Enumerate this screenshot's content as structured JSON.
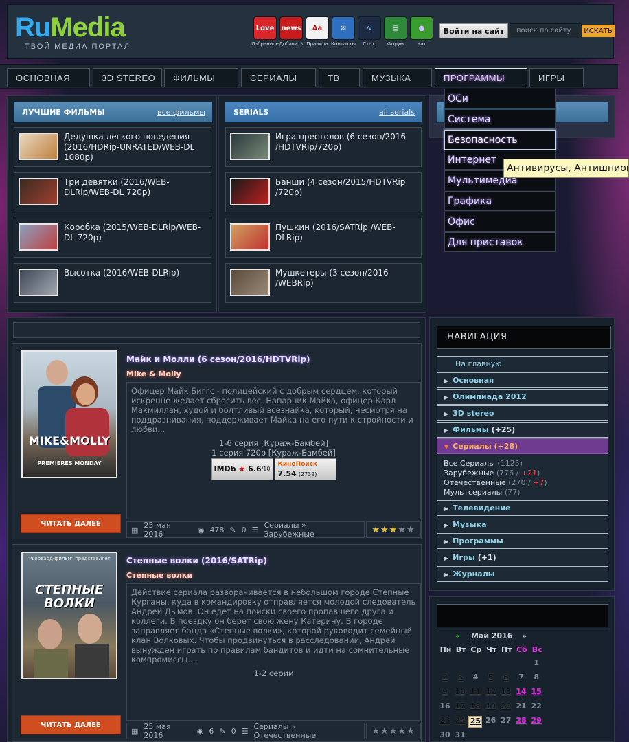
{
  "site": {
    "logo_ru": "Ru",
    "logo_media": "Media",
    "tagline": "ТВОЙ МЕДИА ПОРТАЛ"
  },
  "header_icons": [
    {
      "label": "Избранное",
      "icon": "heart-icon",
      "glyph": "Love"
    },
    {
      "label": "Добавить",
      "icon": "plus-news-icon",
      "glyph": "news"
    },
    {
      "label": "Правила",
      "icon": "rules-icon",
      "glyph": "Aa"
    },
    {
      "label": "Контакты",
      "icon": "mail-icon",
      "glyph": "✉"
    },
    {
      "label": "Стат.",
      "icon": "stats-icon",
      "glyph": "∿"
    },
    {
      "label": "Форум",
      "icon": "forum-icon",
      "glyph": "▤"
    },
    {
      "label": "Чат",
      "icon": "chat-icon",
      "glyph": "●"
    }
  ],
  "login_label": "Войти на сайт",
  "search": {
    "placeholder": "поиск по сайту",
    "button": "ИСКАТЬ"
  },
  "nav": [
    "ОСНОВНАЯ",
    "3D STEREO",
    "ФИЛЬМЫ",
    "СЕРИАЛЫ",
    "ТВ",
    "МУЗЫКА",
    "ПРОГРАММЫ",
    "ИГРЫ"
  ],
  "dropdown": [
    "ОСи",
    "Система",
    "Безопасность",
    "Интернет",
    "Мультимедиа",
    "Графика",
    "Офис",
    "Для приставок"
  ],
  "tooltip": "Антивирусы, Антишпионы",
  "best_films": {
    "title": "ЛУЧШИЕ ФИЛЬМЫ",
    "link": "все фильмы",
    "items": [
      "Дедушка легкого поведения (2016/HDRip-UNRATED/WEB-DL 1080p)",
      "Три девятки (2016/WEB-DLRip/WEB-DL 720p)",
      "Коробка (2015/WEB-DLRip/WEB-DL 720p)",
      "Высотка (2016/WEB-DLRip)"
    ]
  },
  "serials": {
    "title": "SERIALS",
    "link": "all serials",
    "items": [
      "Игра престолов (6 сезон/2016 /HDTVRip/720p)",
      "Банши (4 сезон/2015/HDTVRip /720p)",
      "Пушкин (2016/SATRip /WEB-DLRip)",
      "Мушкетеры (3 сезон/2016 /WEBRip)"
    ]
  },
  "posts": [
    {
      "title": "Майк и Молли (6 сезон/2016/HDTVRip)",
      "subtitle": "Mike & Molly",
      "poster_text": "MIKE&MOLLY",
      "poster_sub": "PREMIERES MONDAY",
      "description": "Офицер Майк Биггс - полицейский с добрым сердцем, который искренне желает сбросить вес. Напарник Майка, офицер Карл Макмиллан, худой и болтливый всезнайка, который, несмотря на поддразнивания, поддерживает Майка на его пути к стройности и любви...",
      "line1": "1-6 серия [Кураж-Бамбей]",
      "line2": "1 серия 720p [Кураж-Бамбей]",
      "imdb_label": "IMDb",
      "imdb": "6.6",
      "imdb_max": "/10",
      "kp_label": "КиноПоиск",
      "kp": "7.54",
      "kp_votes": "(2732)",
      "readmore": "ЧИТАТЬ ДАЛЕЕ",
      "date": "25 мая 2016",
      "views": "478",
      "comments": "0",
      "category": "Сериалы » Зарубежные",
      "rating": 3
    },
    {
      "title": "Степные волки (2016/SATRip)",
      "subtitle": "Степные волки",
      "poster_text": "СТЕПНЫЕ ВОЛКИ",
      "poster_sub": "\"Форвард-фильм\" представляет",
      "description": "Действие сериала разворачивается в небольшом городе Степные Курганы, куда в командировку отправляется молодой следователь Андрей Дымов. Он едет на поиски своего пропавшего друга и коллеги. В поездку он берет свою жену Катерину. В городе заправляет банда «Степные волки», которой руководит семейный клан Волковых. Чтобы продвинуться в расследовании, Андрей вынужден играть по правилам бандитов и идти на сомнительные компромиссы...",
      "line1": "1-2 серии",
      "readmore": "ЧИТАТЬ ДАЛЕЕ",
      "date": "25 мая 2016",
      "views": "6",
      "comments": "0",
      "category": "Сериалы » Отечественные",
      "rating": 0
    }
  ],
  "sidebar": {
    "title": "НАВИГАЦИЯ",
    "home": "На главную",
    "items": [
      {
        "label": "Основная",
        "count": ""
      },
      {
        "label": "Олимпиада 2012",
        "count": ""
      },
      {
        "label": "3D stereo",
        "count": ""
      },
      {
        "label": "Фильмы",
        "count": "(+25)"
      },
      {
        "label": "Сериалы",
        "count": "(+28)"
      },
      {
        "label": "Телевидение",
        "count": ""
      },
      {
        "label": "Музыка",
        "count": ""
      },
      {
        "label": "Программы",
        "count": ""
      },
      {
        "label": "Игры",
        "count": "(+1)"
      },
      {
        "label": "Журналы",
        "count": ""
      }
    ],
    "sub": [
      {
        "label": "Все Сериалы",
        "count": "(1125)",
        "plus": ""
      },
      {
        "label": "Зарубежные",
        "count": "(776 / ",
        "plus": "+21",
        "end": ")"
      },
      {
        "label": "Отечественные",
        "count": "(270 / ",
        "plus": "+7",
        "end": ")"
      },
      {
        "label": "Мультсериалы",
        "count": "(77)",
        "plus": ""
      }
    ]
  },
  "calendar": {
    "prev": "«",
    "month": "Май 2016",
    "next": "»",
    "weekdays": [
      "Пн",
      "Вт",
      "Ср",
      "Чт",
      "Пт",
      "Сб",
      "Вс"
    ],
    "weeks": [
      [
        "",
        "",
        "",
        "",
        "",
        "",
        "1"
      ],
      [
        "2",
        "3",
        "4",
        "5",
        "6",
        "7",
        "8"
      ],
      [
        "9",
        "10",
        "11",
        "12",
        "13",
        "14",
        "15"
      ],
      [
        "16",
        "17",
        "18",
        "19",
        "20",
        "21",
        "22"
      ],
      [
        "23",
        "24",
        "25",
        "26",
        "27",
        "28",
        "29"
      ],
      [
        "30",
        "31",
        "",
        "",
        "",
        "",
        ""
      ]
    ],
    "linked": [
      "2",
      "3",
      "5",
      "6",
      "9",
      "10",
      "11",
      "12",
      "13",
      "14",
      "15",
      "17",
      "18",
      "19",
      "20",
      "23",
      "24",
      "25",
      "28",
      "29"
    ],
    "today": "25"
  }
}
